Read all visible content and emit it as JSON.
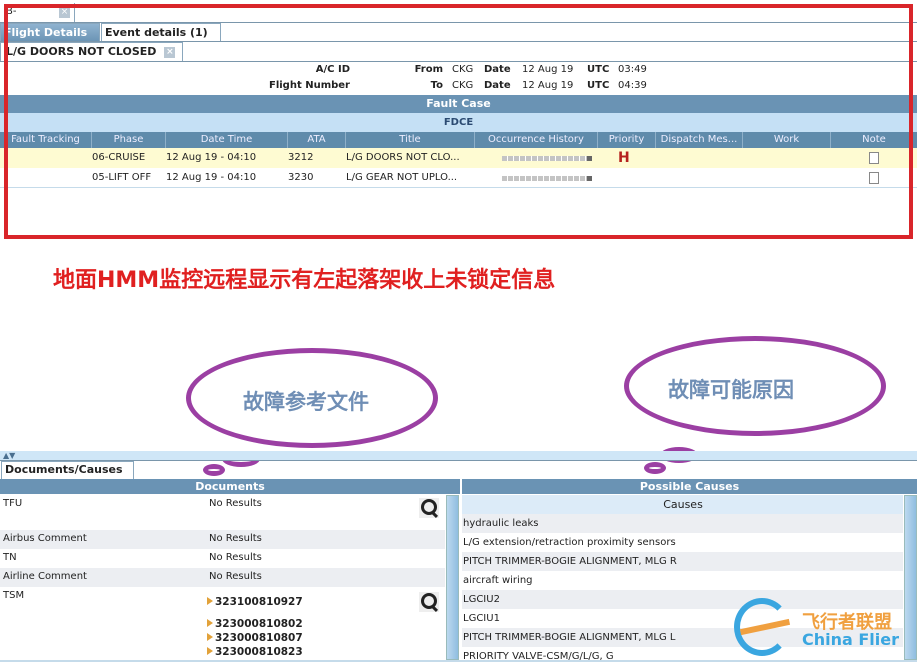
{
  "top_tab": {
    "label": "B-"
  },
  "tabs": [
    {
      "label": "Flight Details",
      "active": true
    },
    {
      "label": "Event details (1)",
      "active": false
    }
  ],
  "fault_tab": {
    "label": "L/G DOORS NOT CLOSED"
  },
  "flight_info": {
    "ac_id_label": "A/C ID",
    "flight_number_label": "Flight Number",
    "from_label": "From",
    "from": "CKG",
    "to_label": "To",
    "to": "CKG",
    "date_label": "Date",
    "dep_date": "12 Aug 19",
    "arr_date": "12 Aug 19",
    "utc_label": "UTC",
    "dep_time": "03:49",
    "arr_time": "04:39"
  },
  "fault_case": {
    "title": "Fault Case",
    "subtitle": "FDCE",
    "columns": [
      "Fault Tracking",
      "Phase",
      "Date Time",
      "ATA",
      "Title",
      "Occurrence History",
      "Priority",
      "Dispatch Mes...",
      "Work",
      "Note"
    ],
    "rows": [
      {
        "fault_tracking": "",
        "phase": "06-CRUISE",
        "datetime": "12 Aug 19 - 04:10",
        "ata": "3212",
        "title": "L/G DOORS NOT CLO...",
        "priority": "H",
        "note_icon": "document-icon"
      },
      {
        "fault_tracking": "",
        "phase": "05-LIFT OFF",
        "datetime": "12 Aug 19 - 04:10",
        "ata": "3230",
        "title": "L/G GEAR NOT UPLO...",
        "priority": "",
        "note_icon": "document-icon"
      }
    ]
  },
  "annotations": {
    "main": "地面HMM监控远程显示有左起落架收上未锁定信息",
    "cloud_left": "故障参考文件",
    "cloud_right": "故障可能原因",
    "colors": {
      "main": "#e02020",
      "cloud": "#9b3fa3",
      "box": "#d9252a"
    }
  },
  "bottom_tab": {
    "label": "Documents/Causes"
  },
  "documents": {
    "title": "Documents",
    "rows": [
      {
        "name": "TFU",
        "value": "No Results"
      },
      {
        "name": "Airbus Comment",
        "value": "No Results"
      },
      {
        "name": "TN",
        "value": "No Results"
      },
      {
        "name": "Airline Comment",
        "value": "No Results"
      },
      {
        "name": "TSM",
        "links": [
          "323100810927",
          "323000810802",
          "323000810807",
          "323000810823"
        ]
      }
    ]
  },
  "causes": {
    "title": "Possible Causes",
    "column": "Causes",
    "items": [
      "hydraulic leaks",
      "L/G extension/retraction proximity sensors",
      "PITCH TRIMMER-BOGIE ALIGNMENT, MLG R",
      "aircraft wiring",
      "LGCIU2",
      "LGCIU1",
      "PITCH TRIMMER-BOGIE ALIGNMENT, MLG L",
      "PRIORITY VALVE-CSM/G/L/G, G"
    ]
  },
  "watermark": {
    "cn": "飞行者联盟",
    "en": "China Flier"
  }
}
